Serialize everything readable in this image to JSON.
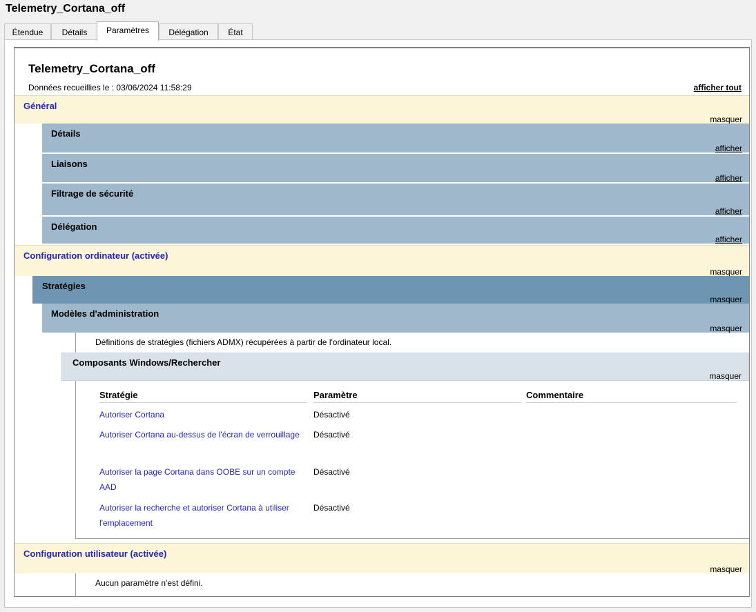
{
  "window": {
    "title": "Telemetry_Cortana_off"
  },
  "tabs": [
    "Étendue",
    "Détails",
    "Paramètres",
    "Délégation",
    "État"
  ],
  "active_tab": "Paramètres",
  "report": {
    "title": "Telemetry_Cortana_off",
    "date_text": "Données recueillies le : 03/06/2024 11:58:29",
    "show_all": "afficher tout"
  },
  "sections": {
    "general": {
      "label": "Général",
      "action": "masquer"
    },
    "details": {
      "label": "Détails",
      "action": "afficher"
    },
    "links": {
      "label": "Liaisons",
      "action": "afficher"
    },
    "security": {
      "label": "Filtrage de sécurité",
      "action": "afficher"
    },
    "delegation": {
      "label": "Délégation",
      "action": "afficher"
    },
    "computer_config": {
      "label": "Configuration ordinateur (activée)",
      "action": "masquer"
    },
    "policies": {
      "label": "Stratégies",
      "action": "masquer"
    },
    "admin_templates": {
      "label": "Modèles d'administration",
      "action": "masquer"
    },
    "admx_note": "Définitions de stratégies (fichiers ADMX) récupérées à partir de l'ordinateur local.",
    "windows_search": {
      "label": "Composants Windows/Rechercher",
      "action": "masquer"
    },
    "user_config": {
      "label": "Configuration utilisateur (activée)",
      "action": "masquer"
    },
    "no_settings": "Aucun paramètre n'est défini."
  },
  "table": {
    "headers": {
      "policy": "Stratégie",
      "setting": "Paramètre",
      "comment": "Commentaire"
    },
    "rows": [
      {
        "policy": "Autoriser Cortana",
        "setting": "Désactivé"
      },
      {
        "policy": "Autoriser Cortana au-dessus de l'écran de verrouillage",
        "setting": "Désactivé"
      },
      {
        "policy": "Autoriser la page Cortana dans OOBE sur un compte AAD",
        "setting": "Désactivé"
      },
      {
        "policy": "Autoriser la recherche et autoriser Cortana à utiliser l'emplacement",
        "setting": "Désactivé"
      }
    ]
  }
}
